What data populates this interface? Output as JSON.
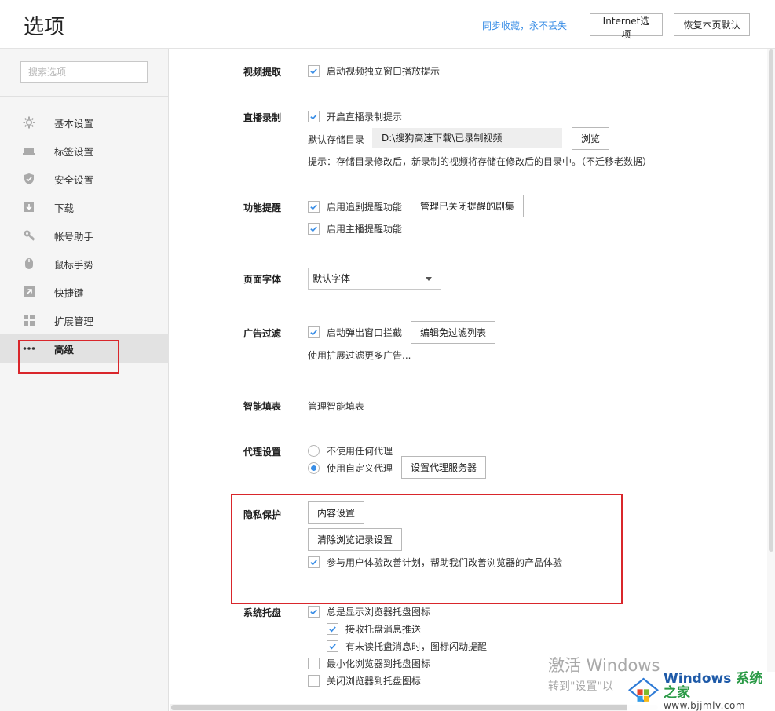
{
  "header": {
    "title": "选项",
    "sync_link": "同步收藏，永不丢失",
    "internet_options": "Internet选项",
    "restore_defaults": "恢复本页默认"
  },
  "sidebar": {
    "search_placeholder": "搜索选项",
    "items": [
      {
        "label": "基本设置",
        "icon": "gear-icon"
      },
      {
        "label": "标签设置",
        "icon": "tab-icon"
      },
      {
        "label": "安全设置",
        "icon": "shield-icon"
      },
      {
        "label": "下载",
        "icon": "download-icon"
      },
      {
        "label": "帐号助手",
        "icon": "key-icon"
      },
      {
        "label": "鼠标手势",
        "icon": "mouse-icon"
      },
      {
        "label": "快捷键",
        "icon": "shortcut-icon"
      },
      {
        "label": "扩展管理",
        "icon": "extensions-icon"
      },
      {
        "label": "高级",
        "icon": "more-icon",
        "active": true
      }
    ]
  },
  "sections": {
    "video": {
      "label": "视频提取",
      "option": "启动视频独立窗口播放提示",
      "checked": true
    },
    "live": {
      "label": "直播录制",
      "option": "开启直播录制提示",
      "checked": true,
      "dir_label": "默认存储目录",
      "dir_value": "D:\\搜狗高速下载\\已录制视频",
      "browse": "浏览",
      "hint": "提示：存储目录修改后，新录制的视频将存储在修改后的目录中。（不迁移老数据）"
    },
    "feature": {
      "label": "功能提醒",
      "option1": "启用追剧提醒功能",
      "manage_btn": "管理已关闭提醒的剧集",
      "option2": "启用主播提醒功能"
    },
    "font": {
      "label": "页面字体",
      "value": "默认字体"
    },
    "adblock": {
      "label": "广告过滤",
      "option": "启动弹出窗口拦截",
      "edit_btn": "编辑免过滤列表",
      "more": "使用扩展过滤更多广告..."
    },
    "autofill": {
      "label": "智能填表",
      "link": "管理智能填表"
    },
    "proxy": {
      "label": "代理设置",
      "option_none": "不使用任何代理",
      "option_custom": "使用自定义代理",
      "server_btn": "设置代理服务器",
      "selected": "使用自定义代理"
    },
    "privacy": {
      "label": "隐私保护",
      "content_btn": "内容设置",
      "clear_btn": "清除浏览记录设置",
      "option": "参与用户体验改善计划，帮助我们改善浏览器的产品体验"
    },
    "tray": {
      "label": "系统托盘",
      "opt1": "总是显示浏览器托盘图标",
      "opt2": "接收托盘消息推送",
      "opt3": "有未读托盘消息时，图标闪动提醒",
      "opt4": "最小化浏览器到托盘图标",
      "opt5": "关闭浏览器到托盘图标"
    }
  },
  "watermark": {
    "line1": "激活 Windows",
    "line2": "转到\"设置\"以"
  },
  "logo": {
    "brand": "Windows",
    "brand_suffix": "系统之家",
    "url": "www.bjjmlv.com"
  },
  "colors": {
    "accent": "#3a8ee6",
    "highlight_box": "#d9262b",
    "active_nav": "#e2e2e2"
  }
}
